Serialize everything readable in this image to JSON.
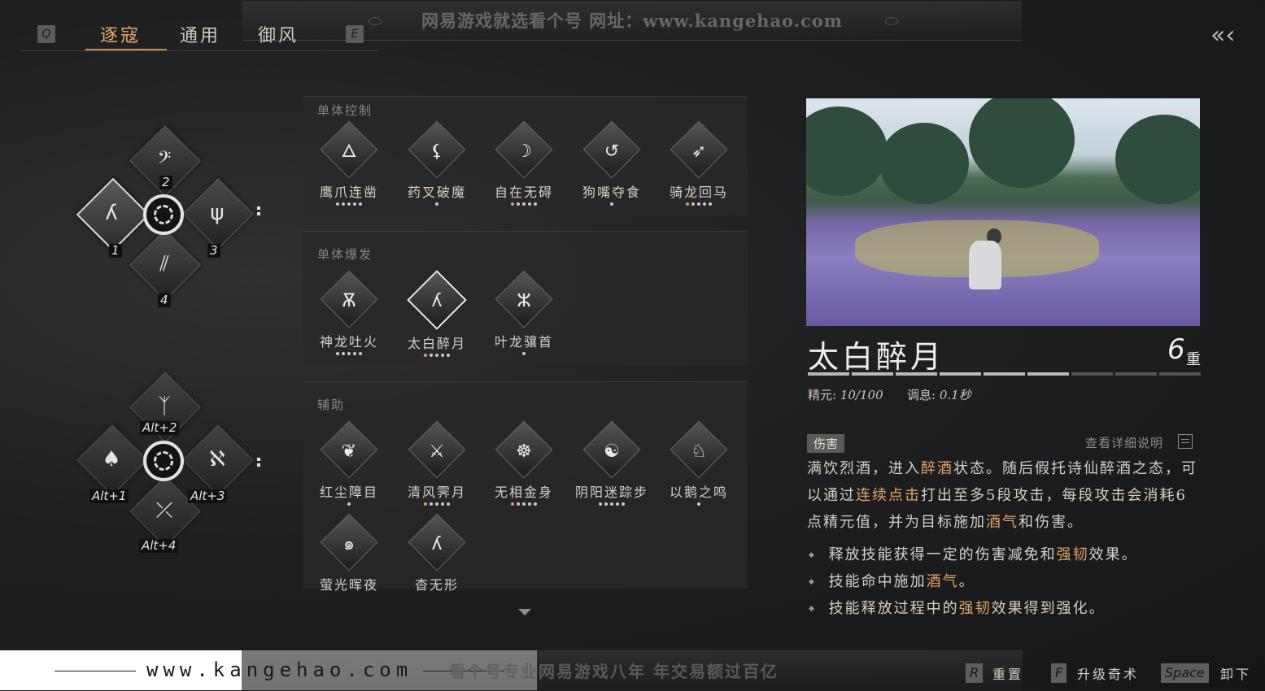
{
  "banner": {
    "top_text": "网易游戏就选看个号  网址：www.kangehao.com",
    "bottom_text": "看个号专业网易游戏八年  年交易额过百亿",
    "site": "www.kangehao.com"
  },
  "tabs": {
    "left_key": "Q",
    "right_key": "E",
    "items": [
      "逐寇",
      "通用",
      "御风"
    ],
    "active": "逐寇"
  },
  "wheel1": {
    "keys": [
      "2",
      "1",
      "3",
      "4"
    ]
  },
  "wheel2": {
    "keys": [
      "Alt+2",
      "Alt+1",
      "Alt+3",
      "Alt+4"
    ]
  },
  "panels": [
    {
      "title": "单体控制",
      "skills": [
        {
          "name": "鹰爪连凿",
          "dots": 5,
          "orange": 0,
          "upgrade": true
        },
        {
          "name": "药叉破魔",
          "dots": 1,
          "orange": 0,
          "upgrade": false
        },
        {
          "name": "自在无碍",
          "dots": 5,
          "orange": 1,
          "upgrade": true
        },
        {
          "name": "狗嘴夺食",
          "dots": 1,
          "orange": 0,
          "upgrade": false
        },
        {
          "name": "骑龙回马",
          "dots": 5,
          "orange": 1,
          "upgrade": true
        }
      ]
    },
    {
      "title": "单体爆发",
      "skills": [
        {
          "name": "神龙吐火",
          "dots": 5,
          "orange": 0,
          "upgrade": true
        },
        {
          "name": "太白醉月",
          "dots": 5,
          "orange": 1,
          "upgrade": false,
          "selected": true
        },
        {
          "name": "叶龙骧首",
          "dots": 1,
          "orange": 0,
          "upgrade": false
        }
      ]
    },
    {
      "title": "辅助",
      "skills": [
        {
          "name": "红尘障目",
          "dots": 1,
          "orange": 0,
          "upgrade": false
        },
        {
          "name": "清风霁月",
          "dots": 5,
          "orange": 1,
          "upgrade": true
        },
        {
          "name": "无相金身",
          "dots": 5,
          "orange": 1,
          "upgrade": false
        },
        {
          "name": "阴阳迷踪步",
          "dots": 5,
          "orange": 0,
          "upgrade": false
        },
        {
          "name": "以鹅之鸣",
          "dots": 1,
          "orange": 0,
          "upgrade": false
        },
        {
          "name": "萤光晖夜",
          "dots": 0,
          "orange": 0,
          "upgrade": false
        },
        {
          "name": "杳无形",
          "dots": 0,
          "orange": 0,
          "upgrade": false
        }
      ]
    }
  ],
  "detail": {
    "name": "太白醉月",
    "tier": "6",
    "tier_unit": "重",
    "tier_progress": 6,
    "tier_total": 9,
    "stat1_label": "精元:",
    "stat1_value": "10/100",
    "stat2_label": "调息:",
    "stat2_value": "0.1秒",
    "tag": "伤害",
    "detail_link": "查看详细说明",
    "desc_parts": [
      "满饮烈酒，进入",
      "醉酒",
      "状态。随后假托诗仙醉酒之态，可以通过",
      "连续点击",
      "打出至多5段攻击，每段攻击会消耗6点精元值，并为目标施加",
      "酒气",
      "和伤害。"
    ],
    "bullets": [
      [
        "释放技能获得一定的伤害减免和",
        "强韧",
        "效果。"
      ],
      [
        "技能命中施加",
        "酒气",
        "。"
      ],
      [
        "技能释放过程中的",
        "强韧",
        "效果得到强化。"
      ]
    ]
  },
  "hints": [
    {
      "key": "R",
      "label": "重置"
    },
    {
      "key": "F",
      "label": "升级奇术"
    },
    {
      "key": "Space",
      "label": "卸下"
    }
  ],
  "colors": {
    "accent": "#e3a365",
    "active_tab": "#e6a869"
  }
}
